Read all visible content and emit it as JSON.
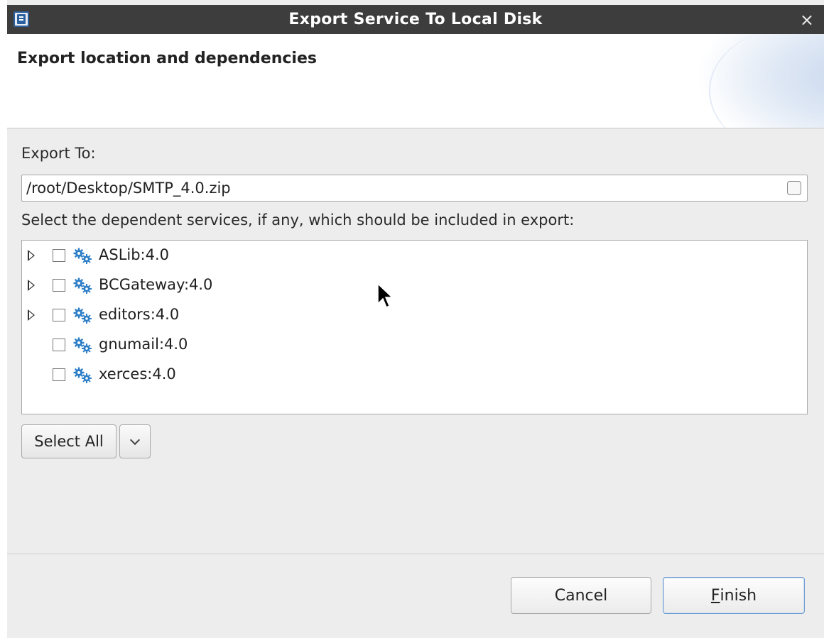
{
  "window": {
    "title": "Export Service To Local Disk",
    "close_label": "×"
  },
  "header": {
    "title": "Export location and dependencies"
  },
  "export": {
    "label": "Export To:",
    "path_value": "/root/Desktop/SMTP_4.0.zip"
  },
  "dependencies": {
    "label": "Select the dependent services, if any, which should be included in export:",
    "items": [
      {
        "label": "ASLib:4.0",
        "expandable": true,
        "checked": false
      },
      {
        "label": "BCGateway:4.0",
        "expandable": true,
        "checked": false
      },
      {
        "label": "editors:4.0",
        "expandable": true,
        "checked": false
      },
      {
        "label": "gnumail:4.0",
        "expandable": false,
        "checked": false
      },
      {
        "label": "xerces:4.0",
        "expandable": false,
        "checked": false
      }
    ],
    "select_all_label": "Select All"
  },
  "footer": {
    "cancel_label": "Cancel",
    "finish_mnemonic": "F",
    "finish_rest": "inish"
  },
  "colors": {
    "titlebar_bg": "#3d3d3d",
    "dialog_bg": "#ededed",
    "gear_icon": "#2f7fc8",
    "primary_border": "#6e9bd1"
  },
  "icons": {
    "service": "gear-icon",
    "expand": "triangle-right-icon",
    "dropdown": "chevron-down-icon",
    "app": "app-icon"
  }
}
